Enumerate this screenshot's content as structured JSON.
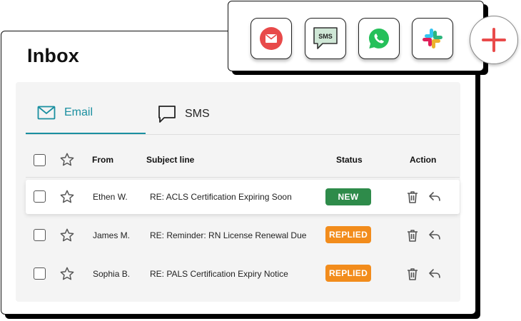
{
  "page": {
    "title": "Inbox"
  },
  "tabs": [
    {
      "label": "Email",
      "icon": "mail-icon",
      "active": true
    },
    {
      "label": "SMS",
      "icon": "chat-bubble-icon",
      "active": false
    }
  ],
  "table": {
    "headers": {
      "from": "From",
      "subject": "Subject line",
      "status": "Status",
      "action": "Action"
    },
    "rows": [
      {
        "from": "Ethen W.",
        "subject": "RE: ACLS Certification Expiring Soon",
        "status": "NEW",
        "highlighted": true
      },
      {
        "from": "James M.",
        "subject": "RE: Reminder: RN License Renewal Due",
        "status": "REPLIED",
        "highlighted": false
      },
      {
        "from": "Sophia B.",
        "subject": "RE: PALS Certification Expiry Notice",
        "status": "REPLIED",
        "highlighted": false
      }
    ]
  },
  "apps": {
    "sms_label": "SMS",
    "items": [
      "gmail-icon",
      "sms-icon",
      "whatsapp-icon",
      "slack-icon"
    ],
    "add": "plus-icon"
  },
  "colors": {
    "accent": "#1a8fa0",
    "new": "#2e8b4a",
    "replied": "#f28c1c",
    "add": "#e94b4b",
    "whatsapp": "#25c05a",
    "gmail": "#e84a4a"
  }
}
